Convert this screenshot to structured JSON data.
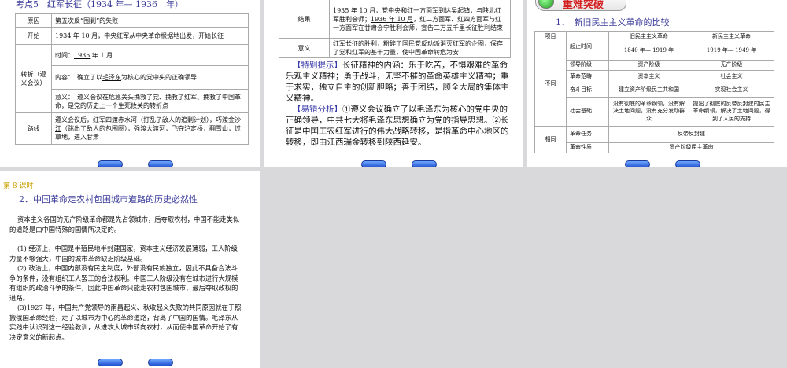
{
  "slide1": {
    "title": "考点5　红军长征（1934 年— 1936　年）",
    "rows": [
      {
        "label": "原因",
        "content": "第五次反“围剿”的失败"
      },
      {
        "label": "开始",
        "content": "1934 年 10 月，中央红军从中央革命根据地出发，开始长征"
      },
      {
        "label": "转折（遵义会议）",
        "time_prefix": "时间：",
        "time_u": "1935",
        "time_suffix": " 年 1 月",
        "content_prefix": "内容：　确立了以",
        "content_u": "毛泽东",
        "content_suffix": "为核心的党中央的正确领导",
        "meaning_prefix": "意义：　遵义会议在危急关头挽救了党、挽救了红军、挽救了中国革命，是党的历史上一个",
        "meaning_u": "生死攸关",
        "meaning_suffix": "的转折点"
      },
      {
        "label": "路线",
        "p1": "遵义会议后，红军四渡",
        "u1": "赤水河",
        "p2": "（打乱了敌人的追剿计划），巧渡",
        "u2": "金沙江",
        "p3": "（跳出了敌人的包围圈），强渡大渡河，飞夺泸定桥，翻雪山，过草地，进入甘肃"
      }
    ]
  },
  "slide2": {
    "rows": [
      {
        "label": "结果",
        "p1": "1935 年 10 月，党中央和红一方面军到达吴起镇，与陕北红军胜利会师；",
        "u1": "1936 年 10 月",
        "p2": "，红二方面军、红四方面军与红一方面军在",
        "u2": "甘肃会宁",
        "p3": "胜利会师，宣告二万五千里长征胜利结束"
      },
      {
        "label": "意义",
        "content": "红军长征的胜利，粉碎了国民党反动派消灭红军的企图，保存了党和红军的基干力量，使中国革命转危为安"
      }
    ],
    "tip_label": "【特别提示】",
    "tip": "长征精神的内涵：乐于吃苦，不惧艰难的革命乐观主义精神；勇于战斗，无坚不摧的革命英雄主义精神；重于求实，独立自主的创新胆略；善于团结，顾全大局的集体主义精神。",
    "error_label": "【易错分析】",
    "error": "①遵义会议确立了以毛泽东为核心的党中央的正确领导，中共七大将毛泽东思想确立为党的指导思想。②长征是中国工农红军进行的伟大战略转移，是指革命中心地区的转移，即由江西瑞金转移到陕西延安。"
  },
  "slide3": {
    "tab": "重难突破",
    "title": "1．　新旧民主主义革命的比较",
    "headers": [
      "项目",
      "",
      "旧民主主义革命",
      "新民主主义革命"
    ],
    "group_diff": "不同",
    "group_same": "相同",
    "diff_rows": [
      {
        "item": "起止时间",
        "old": "1840 年— 1919 年",
        "new": "1919 年— 1949 年"
      },
      {
        "item": "领导阶级",
        "old": "资产阶级",
        "new": "无产阶级"
      },
      {
        "item": "革命范畴",
        "old": "资本主义",
        "new": "社会主义"
      },
      {
        "item": "奋斗目标",
        "old": "建立资产阶级民主共和国",
        "new": "实现社会主义"
      },
      {
        "item": "社会基础",
        "old": "没有彻底的革命纲领，没有解决土地问题，没有充分发动群众",
        "new": "提出了彻底的反帝反封建的民主革命纲领，解决了土地问题，得到了人民的支持"
      }
    ],
    "same_rows": [
      {
        "item": "革命任务",
        "value": "反帝反封建"
      },
      {
        "item": "革命性质",
        "value": "资产阶级民主革命"
      }
    ]
  },
  "slide4": {
    "lesson": "第 8 课时",
    "title": "2．中国革命走农村包围城市道路的历史必然性",
    "intro": "资本主义各国的无产阶级革命都是先占领城市，后夺取农村，中国不能走类似的道路是由中国特殊的国情所决定的。",
    "points": [
      "(1) 经济上，中国是半殖民地半封建国家，资本主义经济发展薄弱，工人阶级力量不够强大，中国的城市革命缺乏阶级基础。",
      "(2) 政治上，中国内部没有民主制度，外部没有民族独立，因此不具备合法斗争的条件，没有组织工人罢工的合法权利。中国工人阶级没有在城市进行大规模有组织的政治斗争的条件，因此中国革命只能走农村包围城市、最后夺取政权的道路。",
      "(3)1927 年，中国共产党领导的南昌起义、秋收起义失败的共同原因就在于照搬俄国革命经验，走了以城市为中心的革命道路，背离了中国的国情。毛泽东从实践中认识到这一经验教训，从进攻大城市转向农村，从而使中国革命开始了有决定意义的新起点。"
    ]
  },
  "colors": {
    "title": "#3a3a9a",
    "lesson": "#c9a000",
    "tab_text": "#d42020",
    "accent_blue": "#1f4fcf"
  }
}
